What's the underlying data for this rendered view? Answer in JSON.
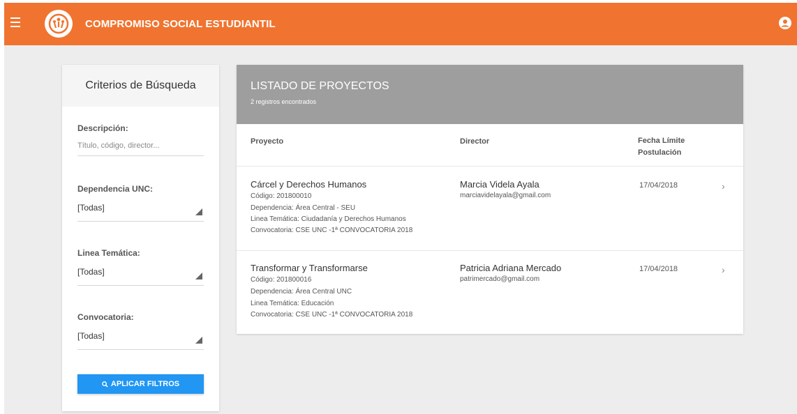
{
  "header": {
    "title": "COMPROMISO SOCIAL ESTUDIANTIL",
    "menu_icon": "hamburger-menu-icon",
    "user_icon": "account-circle-icon",
    "color": "#f07430"
  },
  "filters": {
    "title": "Criterios de Búsqueda",
    "descripcion": {
      "label": "Descripción:",
      "placeholder": "Título, código, director..."
    },
    "dependencia": {
      "label": "Dependencia UNC:",
      "value": "[Todas]"
    },
    "linea": {
      "label": "Linea Temática:",
      "value": "[Todas]"
    },
    "convocatoria": {
      "label": "Convocatoria:",
      "value": "[Todas]"
    },
    "apply_label": "APLICAR FILTROS",
    "apply_icon": "search-icon",
    "apply_color": "#2196f3"
  },
  "results": {
    "title": "LISTADO DE PROYECTOS",
    "count": "2 registros encontrados",
    "columns": {
      "proyecto": "Proyecto",
      "director": "Director",
      "fecha_1": "Fecha Límite",
      "fecha_2": "Postulación"
    },
    "rows": [
      {
        "name": "Cárcel y Derechos Humanos",
        "codigo": "Código: 201800010",
        "dependencia": "Dependencia: Área Central - SEU",
        "linea": "Linea Temática: Ciudadanía y Derechos Humanos",
        "convocatoria": "Convocatoria: CSE UNC -1ª CONVOCATORIA 2018",
        "director": "Marcia Videla Ayala",
        "email": "marciavidelayala@gmail.com",
        "fecha": "17/04/2018"
      },
      {
        "name": "Transformar y Transformarse",
        "codigo": "Código: 201800016",
        "dependencia": "Dependencia: Área Central UNC",
        "linea": "Linea Temática: Educación",
        "convocatoria": "Convocatoria: CSE UNC -1ª CONVOCATORIA 2018",
        "director": "Patricia Adriana Mercado",
        "email": "patrimercado@gmail.com",
        "fecha": "17/04/2018"
      }
    ]
  }
}
